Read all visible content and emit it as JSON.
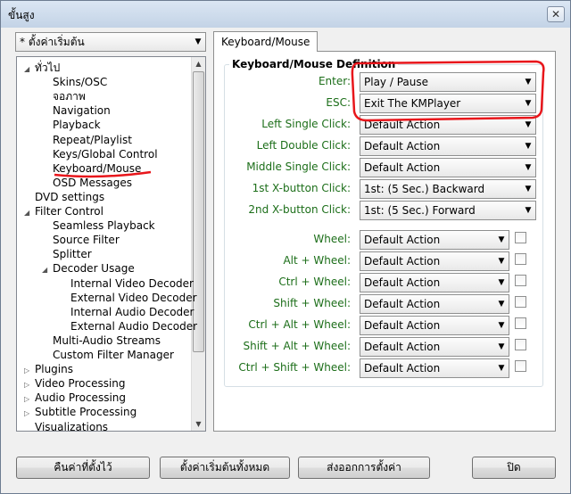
{
  "window": {
    "title": "ขั้นสูง",
    "close_label": "✕"
  },
  "preset": {
    "value": "* ตั้งค่าเริ่มต้น"
  },
  "tree": {
    "items": [
      {
        "label": "ทั่วไป",
        "depth": 1,
        "exp": "◢"
      },
      {
        "label": "Skins/OSC",
        "depth": 2,
        "exp": ""
      },
      {
        "label": "จอภาพ",
        "depth": 2,
        "exp": ""
      },
      {
        "label": "Navigation",
        "depth": 2,
        "exp": ""
      },
      {
        "label": "Playback",
        "depth": 2,
        "exp": ""
      },
      {
        "label": "Repeat/Playlist",
        "depth": 2,
        "exp": ""
      },
      {
        "label": "Keys/Global Control",
        "depth": 2,
        "exp": ""
      },
      {
        "label": "Keyboard/Mouse",
        "depth": 2,
        "exp": ""
      },
      {
        "label": "OSD Messages",
        "depth": 2,
        "exp": ""
      },
      {
        "label": "DVD settings",
        "depth": 1,
        "exp": ""
      },
      {
        "label": "Filter Control",
        "depth": 1,
        "exp": "◢"
      },
      {
        "label": "Seamless Playback",
        "depth": 2,
        "exp": ""
      },
      {
        "label": "Source Filter",
        "depth": 2,
        "exp": ""
      },
      {
        "label": "Splitter",
        "depth": 2,
        "exp": ""
      },
      {
        "label": "Decoder Usage",
        "depth": 2,
        "exp": "◢"
      },
      {
        "label": "Internal Video Decoder",
        "depth": 3,
        "exp": ""
      },
      {
        "label": "External Video Decoder",
        "depth": 3,
        "exp": ""
      },
      {
        "label": "Internal Audio Decoder",
        "depth": 3,
        "exp": ""
      },
      {
        "label": "External Audio Decoder",
        "depth": 3,
        "exp": ""
      },
      {
        "label": "Multi-Audio Streams",
        "depth": 2,
        "exp": ""
      },
      {
        "label": "Custom Filter Manager",
        "depth": 2,
        "exp": ""
      },
      {
        "label": "Plugins",
        "depth": 1,
        "exp": "▷"
      },
      {
        "label": "Video Processing",
        "depth": 1,
        "exp": "▷"
      },
      {
        "label": "Audio Processing",
        "depth": 1,
        "exp": "▷"
      },
      {
        "label": "Subtitle Processing",
        "depth": 1,
        "exp": "▷"
      },
      {
        "label": "Visualizations",
        "depth": 1,
        "exp": ""
      }
    ]
  },
  "tab": {
    "label": "Keyboard/Mouse"
  },
  "group": {
    "title": "Keyboard/Mouse Definition"
  },
  "rows": [
    {
      "label": "Enter:",
      "value": "Play / Pause",
      "checkbox": false
    },
    {
      "label": "ESC:",
      "value": "Exit The KMPlayer",
      "checkbox": false
    },
    {
      "label": "Left Single Click:",
      "value": "Default Action",
      "checkbox": false
    },
    {
      "label": "Left Double Click:",
      "value": "Default Action",
      "checkbox": false
    },
    {
      "label": "Middle Single Click:",
      "value": "Default Action",
      "checkbox": false
    },
    {
      "label": "1st X-button Click:",
      "value": "1st: (5 Sec.) Backward",
      "checkbox": false
    },
    {
      "label": "2nd X-button Click:",
      "value": "1st: (5 Sec.) Forward",
      "checkbox": false
    },
    {
      "label": "Wheel:",
      "value": "Default Action",
      "checkbox": true
    },
    {
      "label": "Alt + Wheel:",
      "value": "Default Action",
      "checkbox": true
    },
    {
      "label": "Ctrl + Wheel:",
      "value": "Default Action",
      "checkbox": true
    },
    {
      "label": "Shift + Wheel:",
      "value": "Default Action",
      "checkbox": true
    },
    {
      "label": "Ctrl + Alt + Wheel:",
      "value": "Default Action",
      "checkbox": true
    },
    {
      "label": "Shift + Alt + Wheel:",
      "value": "Default Action",
      "checkbox": true
    },
    {
      "label": "Ctrl + Shift + Wheel:",
      "value": "Default Action",
      "checkbox": true
    }
  ],
  "buttons": {
    "reset": "คืนค่าที่ตั้งไว้",
    "defaults_all": "ตั้งค่าเริ่มต้นทั้งหมด",
    "export": "ส่งออกการตั้งค่า",
    "close": "ปิด"
  },
  "colors": {
    "label_green": "#1c6e19",
    "annotation_red": "#e8161b"
  }
}
